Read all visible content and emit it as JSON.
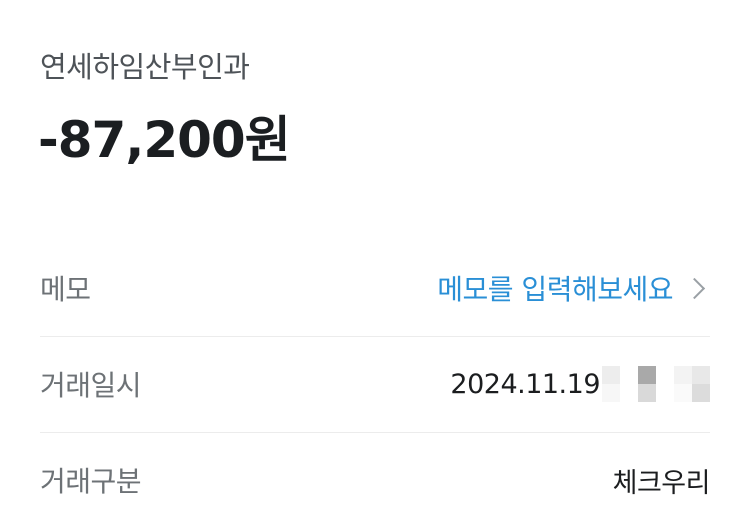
{
  "merchant": "연세하임산부인과",
  "amount": "-87,200원",
  "rows": {
    "memo": {
      "label": "메모",
      "placeholder": "메모를 입력해보세요"
    },
    "datetime": {
      "label": "거래일시",
      "value": "2024.11.19"
    },
    "type": {
      "label": "거래구분",
      "value": "체크우리"
    }
  },
  "colors": {
    "accent": "#2a8fd6",
    "label": "#6d7276",
    "text": "#1b1d1f"
  },
  "icons": {
    "memo_arrow": "chevron-right-icon"
  }
}
